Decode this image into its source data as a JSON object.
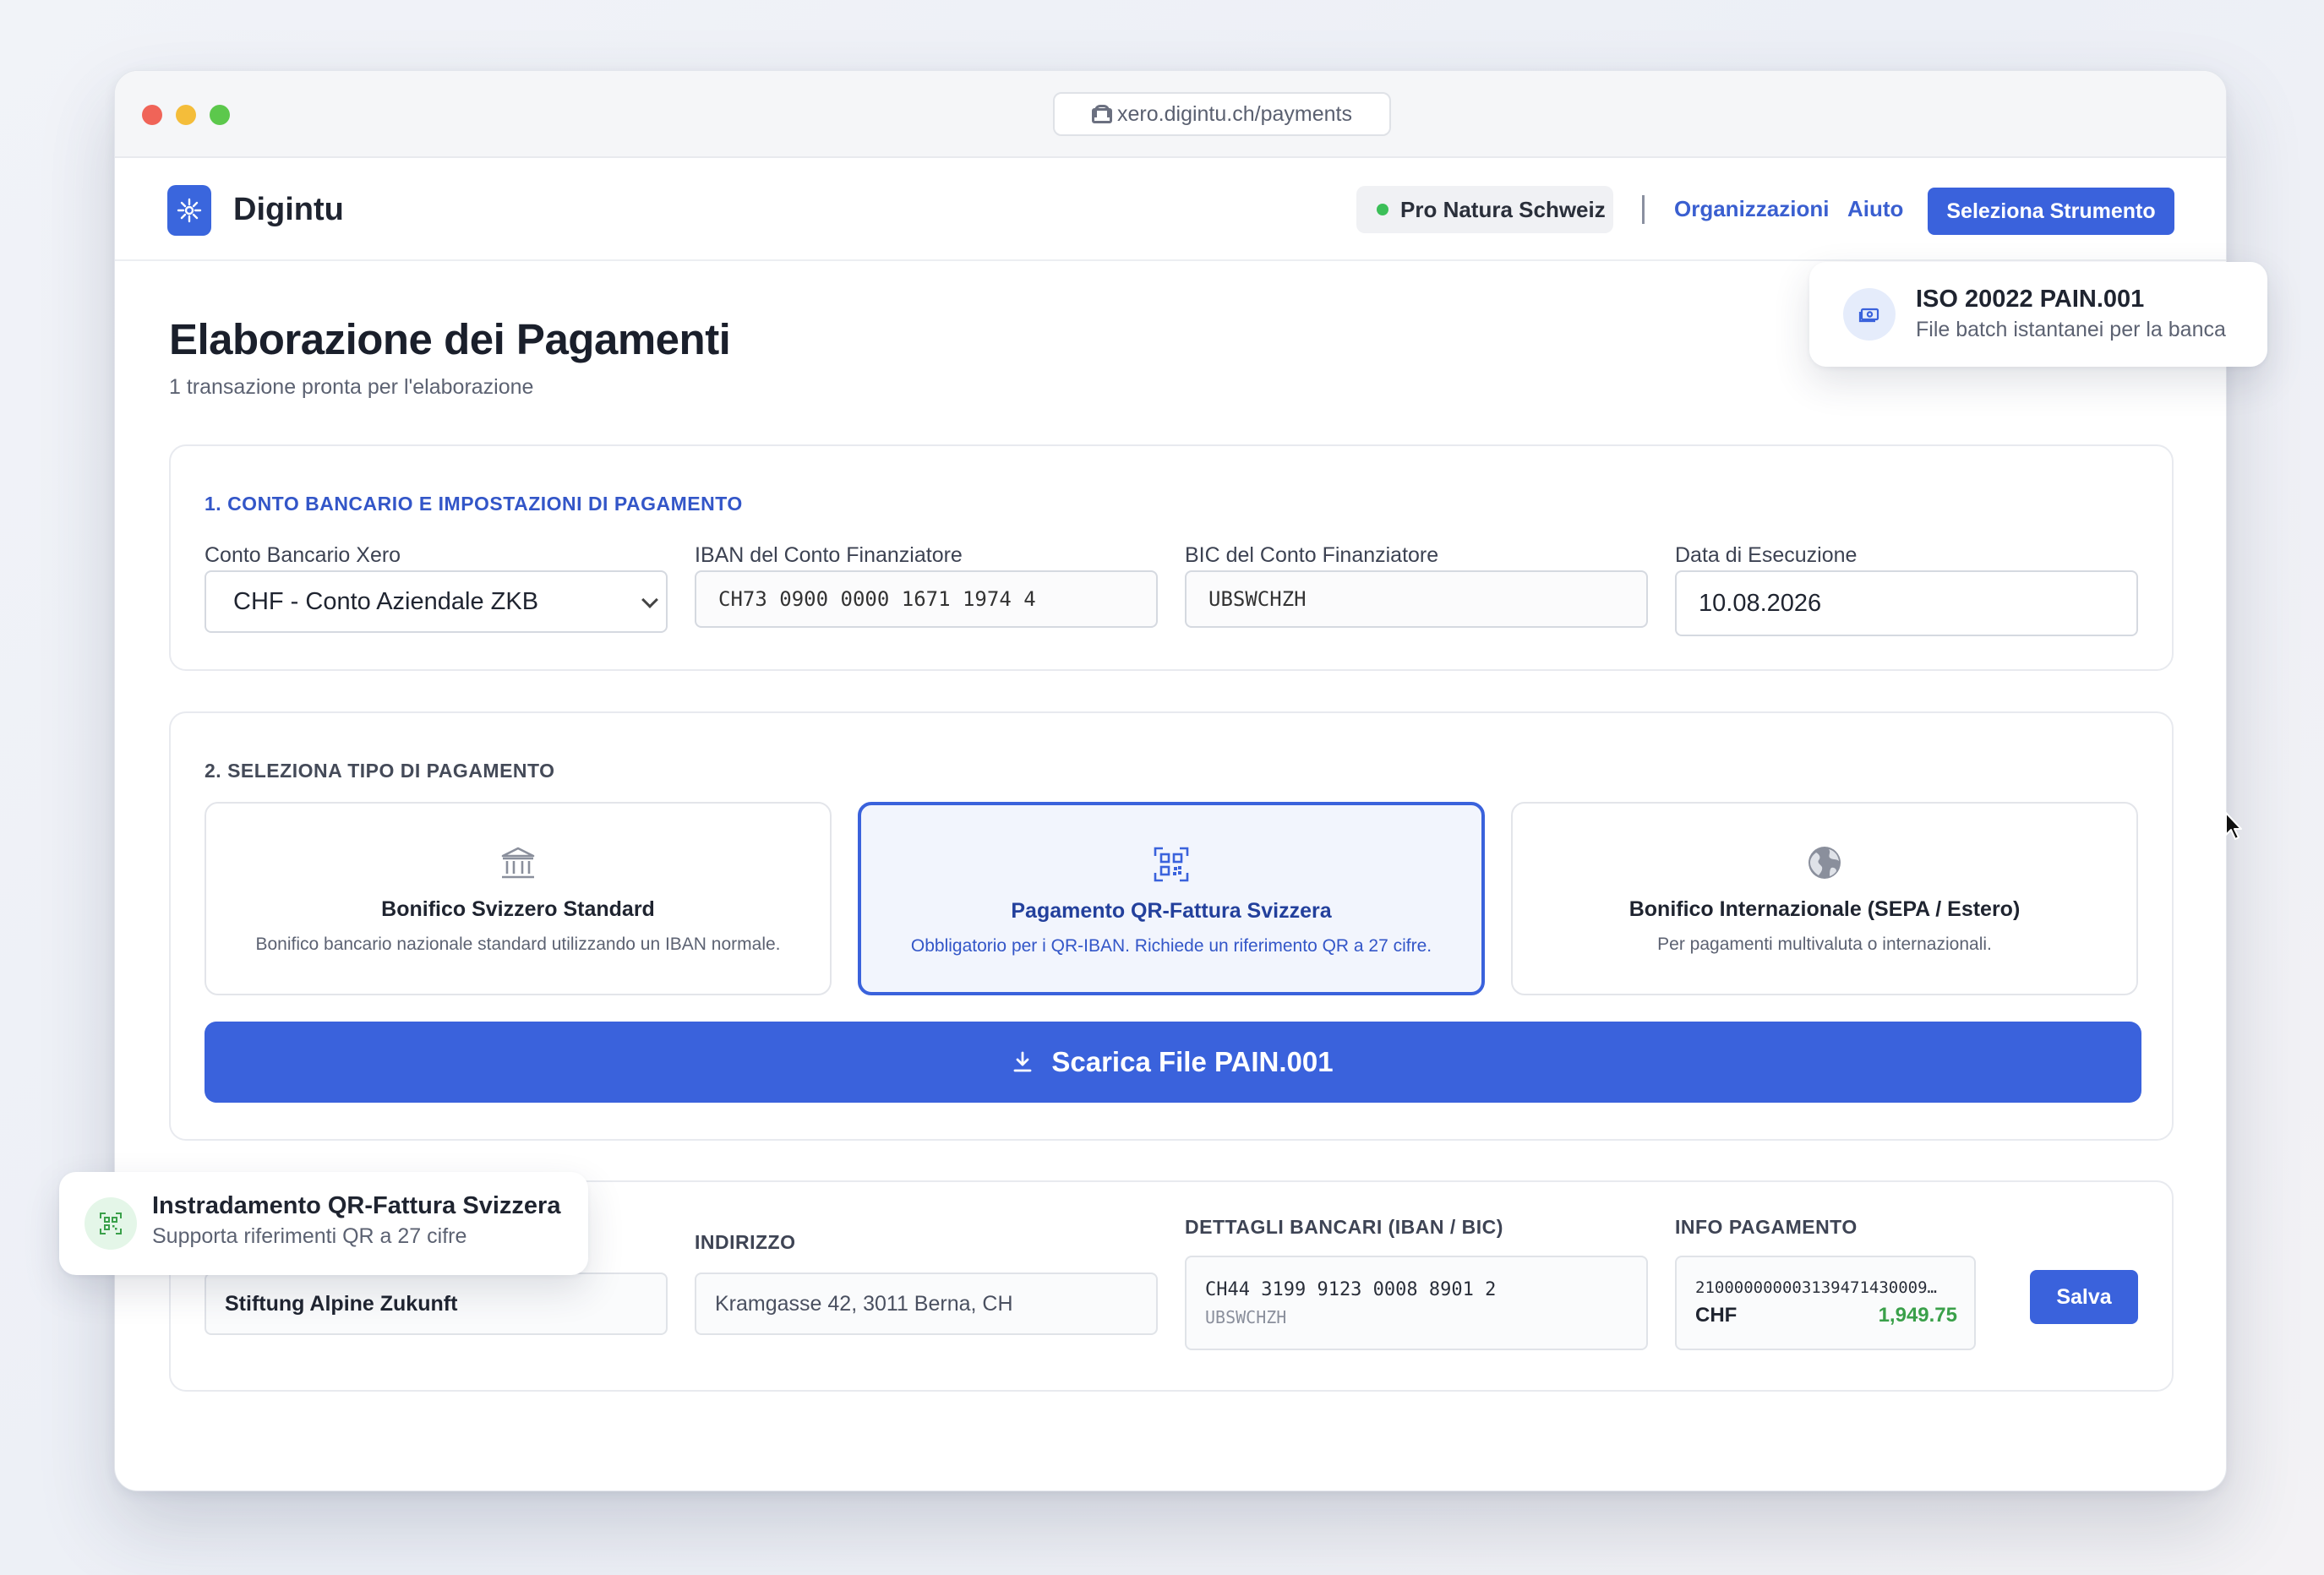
{
  "browser": {
    "url": "xero.digintu.ch/payments"
  },
  "header": {
    "brand": "Digintu",
    "org_name": "Pro Natura Schweiz",
    "nav_organizations": "Organizzazioni",
    "nav_help": "Aiuto",
    "tool_button": "Seleziona Strumento"
  },
  "page": {
    "title": "Elaborazione dei Pagamenti",
    "subtitle": "1 transazione pronta per l'elaborazione"
  },
  "bank_settings": {
    "section_title": "1. CONTO BANCARIO E IMPOSTAZIONI DI PAGAMENTO",
    "account_label": "Conto Bancario Xero",
    "account_value": "CHF - Conto Aziendale ZKB",
    "iban_label": "IBAN del Conto Finanziatore",
    "iban_value": "CH73 0900 0000 1671 1974 4",
    "bic_label": "BIC del Conto Finanziatore",
    "bic_value": "UBSWCHZH",
    "date_label": "Data di Esecuzione",
    "date_value": "10.08.2026"
  },
  "payment_type": {
    "section_title": "2. SELEZIONA TIPO DI PAGAMENTO",
    "options": [
      {
        "icon": "bank-icon",
        "title": "Bonifico Svizzero Standard",
        "description": "Bonifico bancario nazionale standard utilizzando un IBAN normale.",
        "selected": false
      },
      {
        "icon": "qr-code-icon",
        "title": "Pagamento QR-Fattura Svizzera",
        "description": "Obbligatorio per i QR-IBAN. Richiede un riferimento QR a 27 cifre.",
        "selected": true
      },
      {
        "icon": "globe-icon",
        "title": "Bonifico Internazionale (SEPA / Estero)",
        "description": "Per pagamenti multivaluta o internazionali.",
        "selected": false
      }
    ],
    "download_button": "Scarica File PAIN.001"
  },
  "transactions": {
    "columns": {
      "address": "INDIRIZZO",
      "bank_details": "DETTAGLI BANCARI (IBAN / BIC)",
      "payment_info": "INFO PAGAMENTO"
    },
    "rows": [
      {
        "creditor": "Stiftung Alpine Zukunft",
        "address": "Kramgasse 42, 3011 Berna, CH",
        "iban": "CH44 3199 9123 0008 8901 2",
        "bic": "UBSWCHZH",
        "qr_reference": "210000000003139471430009…",
        "currency": "CHF",
        "amount": "1,949.75",
        "save_button": "Salva"
      }
    ]
  },
  "toasts": {
    "iso": {
      "title": "ISO 20022 PAIN.001",
      "subtitle": "File batch istantanei per la banca"
    },
    "qr": {
      "title": "Instradamento QR-Fattura Svizzera",
      "subtitle": "Supporta riferimenti QR a 27 cifre"
    }
  },
  "colors": {
    "accent": "#3a62dc",
    "status_green": "#3cbf58",
    "amount_green": "#3aa04a"
  }
}
